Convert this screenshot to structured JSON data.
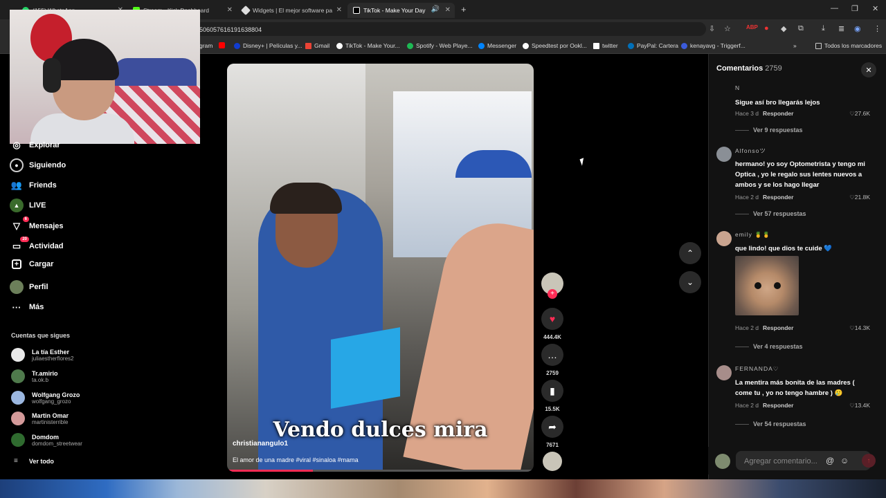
{
  "browser": {
    "tabs": [
      {
        "label": "(155) WhatsApp",
        "color": "#25d366"
      },
      {
        "label": "Stream - Kick Dashboard",
        "color": "#53fc18"
      },
      {
        "label": "Widgets | El mejor software pa",
        "color": "#dddddd"
      },
      {
        "label": "TikTok - Make Your Day",
        "color": "#ffffff",
        "active": true
      }
    ],
    "url": "506057616191638804",
    "bookmarks": [
      {
        "label": "gram",
        "color": "#c13584"
      },
      {
        "label": "",
        "color": "#ff0000"
      },
      {
        "label": "Disney+ | Películas y...",
        "color": "#113ccf"
      },
      {
        "label": "Gmail",
        "color": "#ea4335"
      },
      {
        "label": "TikTok - Make Your...",
        "color": "#ffffff"
      },
      {
        "label": "Spotify - Web Playe...",
        "color": "#1db954"
      },
      {
        "label": "Messenger",
        "color": "#0084ff"
      },
      {
        "label": "Speedtest por Ookl...",
        "color": "#ffffff"
      },
      {
        "label": "twitter",
        "color": "#ffffff"
      },
      {
        "label": "PayPal: Cartera",
        "color": "#0070ba"
      },
      {
        "label": "kenayavg - Triggerf...",
        "color": "#3b5bdb"
      }
    ],
    "all_bookmarks": "Todos los marcadores"
  },
  "nav": {
    "items": [
      {
        "label": "Explorar",
        "icon": "compass-icon"
      },
      {
        "label": "Siguiendo",
        "icon": "following-icon"
      },
      {
        "label": "Friends",
        "icon": "friends-icon"
      },
      {
        "label": "LIVE",
        "icon": "live-icon"
      },
      {
        "label": "Mensajes",
        "icon": "messages-icon",
        "badge": "6"
      },
      {
        "label": "Actividad",
        "icon": "activity-icon",
        "badge": "20"
      },
      {
        "label": "Cargar",
        "icon": "upload-icon"
      },
      {
        "label": "Perfil",
        "icon": "profile-icon"
      },
      {
        "label": "Más",
        "icon": "more-icon"
      }
    ]
  },
  "following": {
    "title": "Cuentas que sigues",
    "accounts": [
      {
        "name": "La tía Esther",
        "handle": "juliaestherflores2",
        "color": "#e8e8e8"
      },
      {
        "name": "Tr.amirio",
        "handle": "ta.ok.b",
        "color": "#4f7a4c"
      },
      {
        "name": "Wolfgang Grozo",
        "handle": "wolfgang_grozo",
        "color": "#9bb7e0"
      },
      {
        "name": "Martin Omar",
        "handle": "martinisterrible",
        "color": "#d49a9a"
      },
      {
        "name": "Domdom",
        "handle": "domdom_streetwear",
        "color": "#2f6b2f"
      }
    ],
    "see_all": "Ver todo"
  },
  "video": {
    "caption": "Vendo dulces mira",
    "username": "christianangulo1",
    "description": "El amor de una madre #viral #sinaloa #mama",
    "progress": 0.28
  },
  "actions": {
    "likes": "444.4K",
    "comments": "2759",
    "saves": "15.5K",
    "shares": "7671"
  },
  "comments": {
    "title": "Comentarios",
    "count": "2759",
    "list": [
      {
        "user": "N",
        "text": "Sigue así bro llegarás lejos",
        "time": "Hace 3 d",
        "reply": "Responder",
        "likes": "27.6K",
        "replies": "Ver 9 respuestas",
        "avatar": "#444444"
      },
      {
        "user": "Alfonsoツ",
        "text": "hermano! yo soy Optometrista y tengo mi Optica , yo le regalo sus lentes nuevos a ambos y se los hago llegar",
        "time": "Hace 2 d",
        "reply": "Responder",
        "likes": "21.8K",
        "replies": "Ver 57 respuestas",
        "avatar": "#8a8f96"
      },
      {
        "user": "emily 🍍🍍",
        "text": "que lindo! que dios te cuide 💙",
        "time": "Hace 2 d",
        "reply": "Responder",
        "likes": "14.3K",
        "replies": "Ver 4 respuestas",
        "avatar": "#c9a48f"
      },
      {
        "user": "FERNANDA♡",
        "text": "La mentira más bonita de las madres ( come tu , yo no tengo hambre ) 🥲",
        "time": "Hace 2 d",
        "reply": "Responder",
        "likes": "13.4K",
        "replies": "Ver 54 respuestas",
        "avatar": "#a78d8a"
      }
    ],
    "add_placeholder": "Agregar comentario..."
  }
}
